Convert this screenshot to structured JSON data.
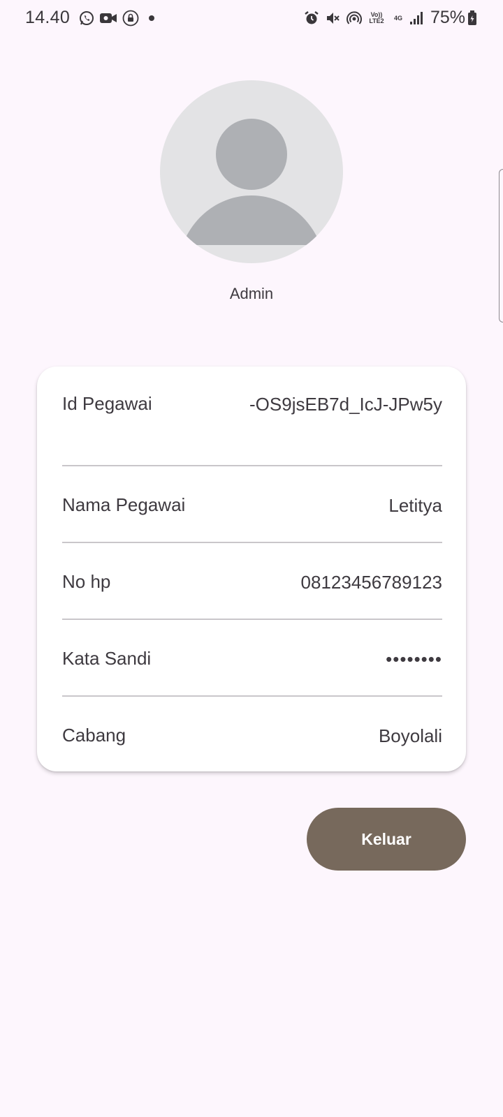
{
  "status_bar": {
    "time": "14.40",
    "battery": "75%",
    "network_volte": "Vo)) LTE2",
    "network_4g": "4G",
    "icons_left": [
      "whatsapp-icon",
      "video-call-icon",
      "lock-icon",
      "dot-icon"
    ],
    "icons_right": [
      "alarm-icon",
      "mute-icon",
      "hotspot-icon",
      "volte-icon",
      "network-4g-icon",
      "signal-icon",
      "battery-icon"
    ]
  },
  "profile": {
    "name": "Admin"
  },
  "details": {
    "rows": [
      {
        "label": "Id Pegawai",
        "value": "-OS9jsEB7d_IcJ-JPw5y"
      },
      {
        "label": "Nama Pegawai",
        "value": "Letitya"
      },
      {
        "label": "No hp",
        "value": "08123456789123"
      },
      {
        "label": "Kata Sandi",
        "value": "••••••••"
      },
      {
        "label": "Cabang",
        "value": "Boyolali"
      }
    ]
  },
  "actions": {
    "logout_label": "Keluar"
  },
  "colors": {
    "background": "#fdf6fd",
    "card": "#ffffff",
    "button": "#77695c",
    "avatar_bg": "#e3e3e5",
    "avatar_fg": "#aeb0b4"
  }
}
